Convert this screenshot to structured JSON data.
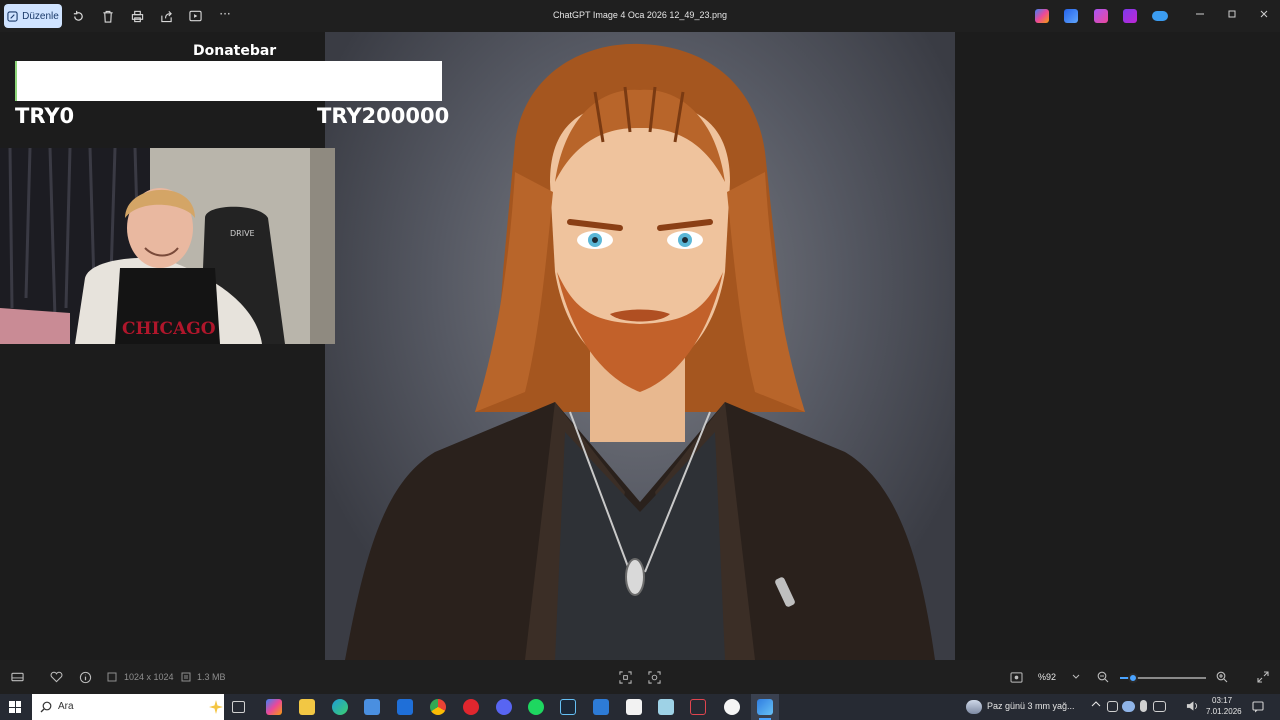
{
  "toolbar": {
    "edit_label": "Düzenle",
    "title": "ChatGPT Image 4 Oca 2026 12_49_23.png",
    "more_label": "···"
  },
  "donatebar": {
    "title": "Donatebar",
    "min_label": "TRY0",
    "max_label": "TRY200000",
    "progress": 0.0
  },
  "webcam": {
    "shirt_text": "CHICAGO",
    "chair_text": "DRIVE"
  },
  "statusbar": {
    "dimensions": "1024 x 1024",
    "file_size": "1.3 MB",
    "zoom": "%92",
    "zoom_level": 0.15
  },
  "taskbar": {
    "search_placeholder": "Ara",
    "weather": "Paz günü 3 mm yağ...",
    "time": "03:17",
    "date": "7.01.2026"
  },
  "colors": {
    "accent": "#4aa3ff",
    "edit_button_bg": "#cfe3ff",
    "donate_bar_edge": "#8ed67a"
  }
}
